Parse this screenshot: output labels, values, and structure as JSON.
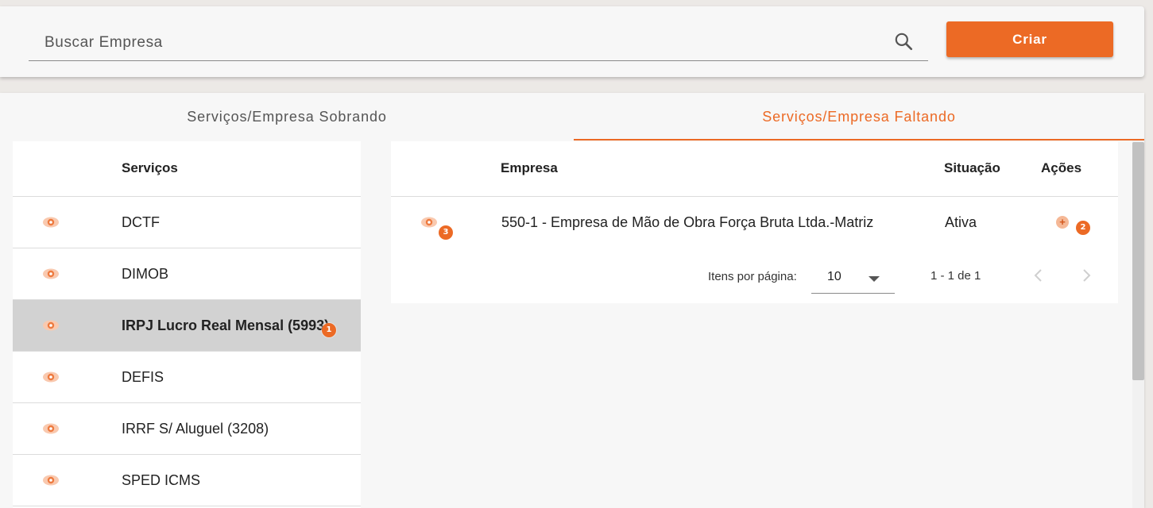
{
  "search": {
    "placeholder": "Buscar Empresa"
  },
  "toolbar": {
    "create_label": "Criar"
  },
  "tabs": [
    {
      "label": "Serviços/Empresa Sobrando",
      "active": false
    },
    {
      "label": "Serviços/Empresa Faltando",
      "active": true
    }
  ],
  "services_table": {
    "header": "Serviços",
    "rows": [
      {
        "label": "DCTF",
        "selected": false
      },
      {
        "label": "DIMOB",
        "selected": false
      },
      {
        "label": "IRPJ Lucro Real Mensal (5993)",
        "selected": true,
        "badge": "1"
      },
      {
        "label": "DEFIS",
        "selected": false
      },
      {
        "label": "IRRF S/ Aluguel (3208)",
        "selected": false
      },
      {
        "label": "SPED ICMS",
        "selected": false
      }
    ]
  },
  "companies_table": {
    "headers": {
      "empresa": "Empresa",
      "situacao": "Situação",
      "acoes": "Ações"
    },
    "rows": [
      {
        "empresa": "550-1 - Empresa de Mão de Obra Força Bruta Ltda.-Matriz",
        "situacao": "Ativa",
        "eye_badge": "3",
        "action_badge": "2"
      }
    ],
    "paginator": {
      "items_per_page_label": "Itens por página:",
      "page_size": "10",
      "range_label": "1 - 1 de 1"
    }
  },
  "colors": {
    "accent": "#ec6a25",
    "selected_row": "#d2d2d2",
    "eye_icon": "#f4a57c"
  },
  "icons": {
    "search": "search-icon",
    "row_view": "eye-icon",
    "row_add": "plus-circle-icon",
    "page_prev": "chevron-left-icon",
    "page_next": "chevron-right-icon"
  }
}
